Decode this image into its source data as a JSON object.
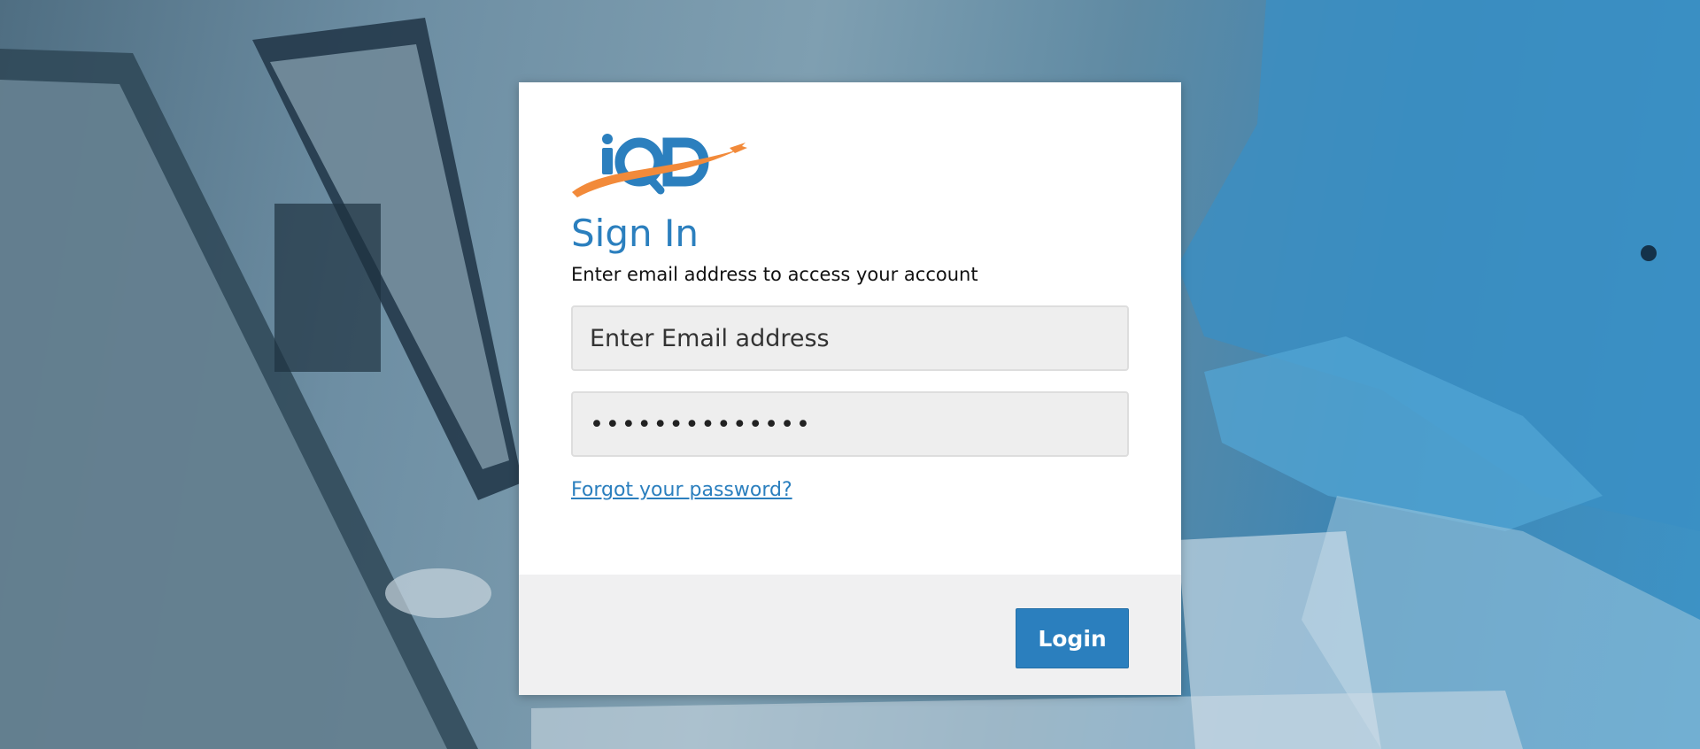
{
  "brand": {
    "logo_text": "iQD",
    "primary_color": "#2b7fbe",
    "accent_color": "#f28a3a"
  },
  "signin": {
    "title": "Sign In",
    "subtitle": "Enter email address to access your account",
    "email_placeholder": "Enter Email address",
    "password_value": "••••••••••••••",
    "forgot_link": "Forgot your password?",
    "login_label": "Login"
  }
}
